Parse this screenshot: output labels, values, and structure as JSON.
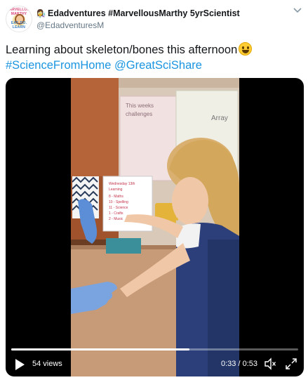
{
  "user": {
    "badge_emoji": "👩‍🔬",
    "display_name": "Edadventures #MarvellousMarthy 5yrScientist",
    "handle": "@EdadventuresM",
    "avatar_text_top": "MARVELLOUS MARTHY",
    "avatar_text_bottom": "EAT. DO. LEARN"
  },
  "tweet": {
    "text": "Learning about skeleton/bones this afternoon",
    "hashtags": [
      "#ScienceFromHome",
      "@GreatSciShare"
    ]
  },
  "video": {
    "views": "54 views",
    "time": "0:33 / 0:53",
    "progress": 0.62,
    "scene": {
      "board_lines": [
        "This weeks",
        "challenges",
        "Array"
      ],
      "card_lines": [
        "Wednesday 13th",
        "Learning",
        "8 - Maths",
        "10 - Spelling",
        "11 - Science",
        "1 - Crafts",
        "2 - Music"
      ]
    }
  },
  "colors": {
    "link": "#1b95e0",
    "text": "#14171a",
    "secondary": "#657786"
  },
  "icons": [
    "caret-down-icon",
    "play-icon",
    "volume-icon",
    "fullscreen-icon"
  ]
}
